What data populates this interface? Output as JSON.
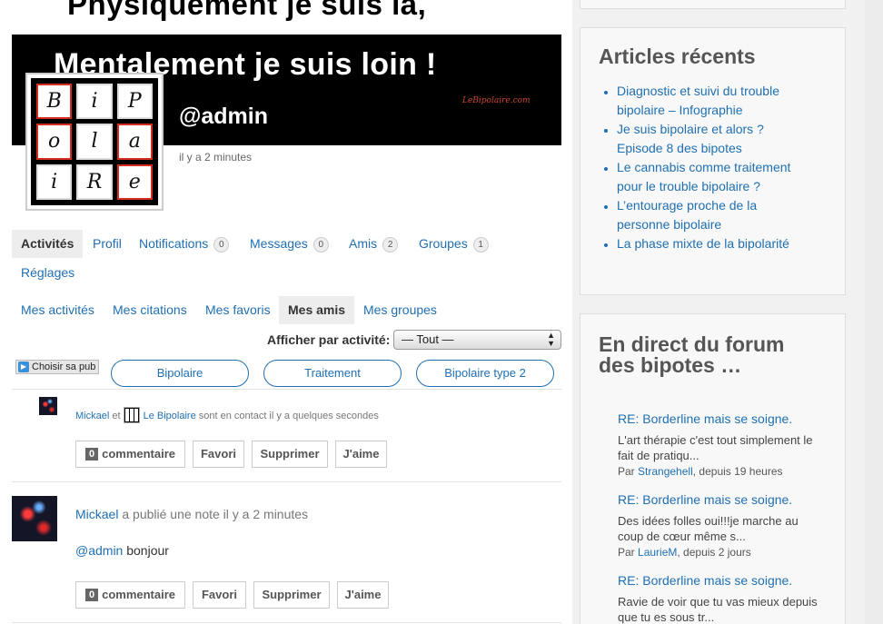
{
  "cover": {
    "line1": "Physiquement je suis là,",
    "line2": "Mentalement je suis loin !",
    "signature": "LeBipolaire.com"
  },
  "avatar_letters": [
    "B",
    "i",
    "P",
    "o",
    "l",
    "a",
    "i",
    "R",
    "e"
  ],
  "profile": {
    "username": "@admin",
    "last_active": "il y a 2 minutes"
  },
  "nav": {
    "items": [
      {
        "label": "Activités"
      },
      {
        "label": "Profil"
      },
      {
        "label": "Notifications",
        "count": "0"
      },
      {
        "label": "Messages",
        "count": "0"
      },
      {
        "label": "Amis",
        "count": "2"
      },
      {
        "label": "Groupes",
        "count": "1"
      },
      {
        "label": "Réglages"
      }
    ]
  },
  "subnav": {
    "items": [
      {
        "label": "Mes activités"
      },
      {
        "label": "Mes citations"
      },
      {
        "label": "Mes favoris"
      },
      {
        "label": "Mes amis"
      },
      {
        "label": "Mes groupes"
      }
    ]
  },
  "filter": {
    "label": "Afficher par activité:",
    "selected": "— Tout —"
  },
  "ads": {
    "button": "Choisir sa pub",
    "tags": [
      "Bipolaire",
      "Traitement",
      "Bipolaire type 2"
    ]
  },
  "activities": [
    {
      "user": "Mickael",
      "connector": "et",
      "user2": "Le Bipolaire",
      "action": "sont en contact il y a quelques secondes",
      "buttons": {
        "comment_count": "0",
        "comment": "commentaire",
        "fav": "Favori",
        "delete": "Supprimer",
        "like": "J'aime"
      }
    },
    {
      "user": "Mickael",
      "action": "a publié une note il y a 2 minutes",
      "mention": "@admin",
      "body": "bonjour",
      "buttons": {
        "comment_count": "0",
        "comment": "commentaire",
        "fav": "Favori",
        "delete": "Supprimer",
        "like": "J'aime"
      }
    }
  ],
  "sidebar": {
    "recent": {
      "title": "Articles récents",
      "items": [
        {
          "line1": "Diagnostic et suivi du trouble",
          "line2": "bipolaire – Infographie"
        },
        {
          "line1": "Je suis bipolaire et alors ?",
          "line2": "Episode 8 des bipotes"
        },
        {
          "line1": "Le cannabis comme traitement",
          "line2": "pour le trouble bipolaire ?"
        },
        {
          "line1": "L’entourage proche de la",
          "line2": "personne bipolaire"
        },
        {
          "line1": "La phase mixte de la bipolarité",
          "line2": ""
        }
      ]
    },
    "forum": {
      "title_line1": "En direct du forum",
      "title_line2": "des bipotes …",
      "by": "Par",
      "items": [
        {
          "title": "RE: Borderline mais se soigne.",
          "excerpt_line1": "L'art thérapie c'est tout simplement le",
          "excerpt_line2": "fait de pratiqu...",
          "author": "Strangehell",
          "time": ", depuis 19 heures"
        },
        {
          "title": "RE: Borderline mais se soigne.",
          "excerpt_line1": "Des idées folles oui!!!je marche au",
          "excerpt_line2": "coup de cœur même s...",
          "author": "LaurieM",
          "time": ", depuis 2 jours"
        },
        {
          "title": "RE: Borderline mais se soigne.",
          "excerpt_line1": "Ravie de voir que tu vas mieux depuis",
          "excerpt_line2": "que tu es sous tr...",
          "author": "",
          "time": ""
        }
      ]
    }
  }
}
